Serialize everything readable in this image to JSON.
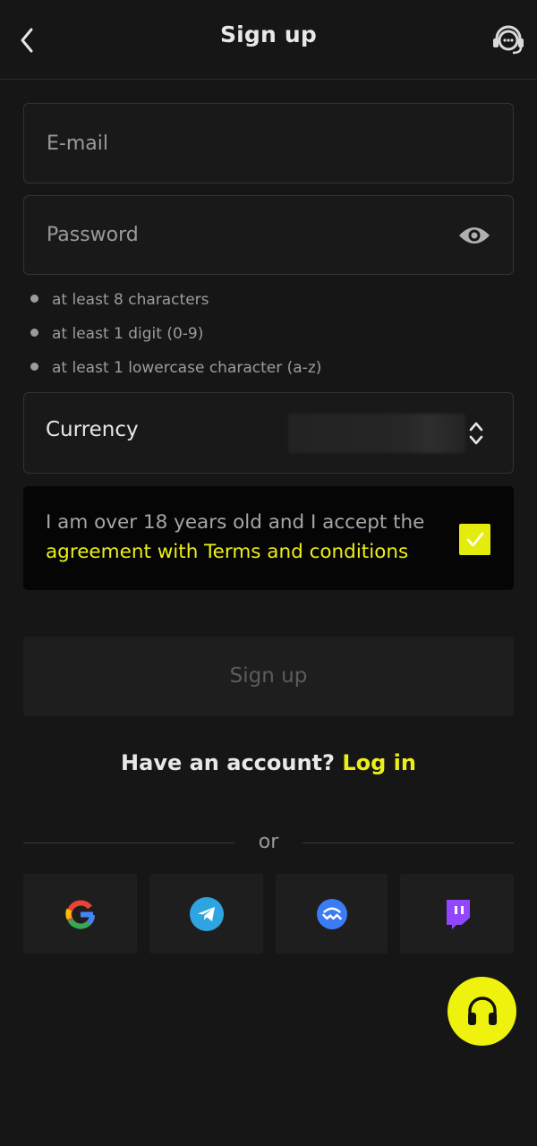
{
  "header": {
    "title": "Sign up",
    "back_icon": "chevron-left-icon",
    "support_icon": "support-agent-icon"
  },
  "form": {
    "email": {
      "placeholder": "E-mail",
      "value": ""
    },
    "password": {
      "placeholder": "Password",
      "value": "",
      "visibility_icon": "eye-icon"
    },
    "password_rules": [
      "at least 8 characters",
      "at least 1 digit (0-9)",
      "at least 1 lowercase character (a-z)"
    ],
    "currency": {
      "label": "Currency",
      "value": "",
      "icon": "sort-arrows-icon"
    },
    "terms": {
      "text": "I am over 18 years old and I accept the",
      "link": "agreement with Terms and conditions",
      "checked": true
    },
    "submit_label": "Sign up"
  },
  "login_prompt": {
    "text": "Have an account?",
    "link": "Log in"
  },
  "divider_text": "or",
  "social_buttons": [
    {
      "name": "google",
      "icon": "google-icon"
    },
    {
      "name": "telegram",
      "icon": "telegram-icon"
    },
    {
      "name": "walletconnect",
      "icon": "walletconnect-icon"
    },
    {
      "name": "twitch",
      "icon": "twitch-icon"
    }
  ],
  "fab": {
    "icon": "headphones-icon"
  },
  "colors": {
    "background": "#161616",
    "accent": "#ecee1a",
    "field_border": "#333333",
    "button_bg": "#1e1e1e"
  }
}
